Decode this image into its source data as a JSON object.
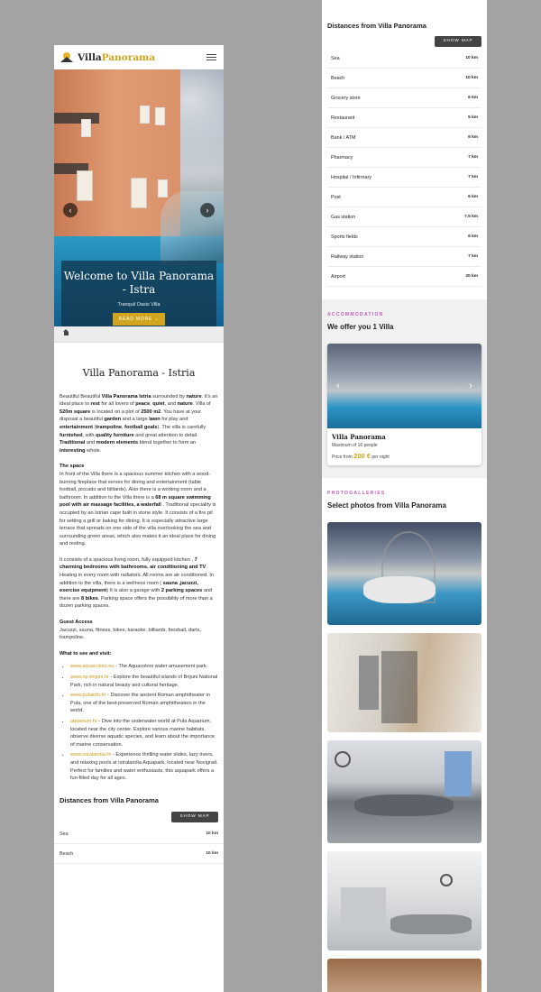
{
  "left": {
    "brand": {
      "part1": "Villa",
      "part2": "Panorama"
    },
    "hero": {
      "title": "Welcome to Villa Panorama - Istra",
      "subtitle": "Tranquil Oasis Villa",
      "button": "READ MORE ⌄",
      "prev": "‹",
      "next": "›"
    },
    "page_title": "Villa Panorama - Istria",
    "intro_html": "Beautiful Beautiful <b>Villa Panorama Istria</b> surrounded by <b>nature</b>. It's an ideal place to <b>rest</b> for all lovers of <b>peace</b>, <b>quiet</b>, and <b>nature</b>. Villa of <b>520m square</b> is located on a plot of <b>2500 m2</b>. You have at your disposal a beautiful <b>garden</b> and a large <b>lawn</b> for play and <b>entertainment</b> (<b>trampoline</b>, <b>football goals</b>). The villa is carefully <b>furnished</b>, with <b>quality furniture</b> and great attention to detail. <b>Traditional</b> and <b>modern elements</b> blend together to form an <b>interesting</b> whole.",
    "space_heading": "The space",
    "space_html": "In front of the Villa there is a spacious summer kitchen with a wood-burning fireplace that serves for dining and entertainment (table football, piccado and billiards). Also there is a working room and a bathroom. In addition to the Villa there is a <b>68 m square swimming pool with air massage facilities, a waterfall</b> . Traditional speciality is occupied by an Istrian cape built in stone style. It consists of a fire pit for setting a grill or baking for dining. It is especially attractive large terrace that spreads on one side of the villa overlooking the sea and surrounding green areas, which also makes it an ideal place for dining and resting.",
    "space2_html": "It consists of a spacious living room, fully equipped kitchen , <b>7 charming bedrooms with bathrooms, air conditioning and TV</b>. Heating in every room with radiators. All rooms are air conditioned. In addition to the villa, there is a wellness room ( <b>sauna ,jacuzzi, exercise equipment</b>) It is also a garage with <b>2 parking spaces</b> and there are <b>8 bikes</b>. Parking space offers the possibility of more than a dozen parking spaces.",
    "guest_heading": "Guest Access",
    "guest_text": "Jacuzzi, sauna, fitness, bikes, karaoke, billiards, foosball, darts, trampoline.",
    "visit_heading": "What to see and visit:",
    "visit_items": [
      {
        "link": "www.aquacolors.eu",
        "text": " - The Aquacolors water amusement park."
      },
      {
        "link": "www.np-brijuni.hr",
        "text": " - Explore the beautiful islands of Brijuni National Park, rich in natural beauty and cultural heritage."
      },
      {
        "link": "www.pulainfo.hr",
        "text": " - Discover the ancient Roman amphitheater in Pula, one of the best-preserved Roman amphitheaters in the world."
      },
      {
        "link": "aquarium.hr",
        "text": " - Dive into the underwater world at Pula Aquarium, located near the city center. Explore various marine habitats, observe diverse aquatic species, and learn about the importance of marine conservation."
      },
      {
        "link": "www.istralandia.hr",
        "text": " - Experience thrilling water slides, lazy rivers, and relaxing pools at Istralandia Aquapark, located near Novigrad. Perfect for families and water enthusiasts, this aquapark offers a fun-filled day for all ages."
      }
    ],
    "distances_title": "Distances from Villa Panorama",
    "show_map": "SHOW MAP",
    "distances": [
      {
        "place": "Sea",
        "km": "10 km"
      },
      {
        "place": "Beach",
        "km": "10 km"
      }
    ]
  },
  "right": {
    "distances_title": "Distances from Villa Panorama",
    "show_map": "SHOW MAP",
    "distances": [
      {
        "place": "Sea",
        "km": "10 km"
      },
      {
        "place": "Beach",
        "km": "10 km"
      },
      {
        "place": "Grocery store",
        "km": "6 km"
      },
      {
        "place": "Restaurant",
        "km": "5 km"
      },
      {
        "place": "Bank / ATM",
        "km": "6 km"
      },
      {
        "place": "Pharmacy",
        "km": "7 km"
      },
      {
        "place": "Hospital / Infirmary",
        "km": "7 km"
      },
      {
        "place": "Post",
        "km": "6 km"
      },
      {
        "place": "Gas station",
        "km": "7.5 km"
      },
      {
        "place": "Sports fields",
        "km": "6 km"
      },
      {
        "place": "Railway station",
        "km": "7 km"
      },
      {
        "place": "Airport",
        "km": "20 km"
      }
    ],
    "accommodation_kicker": "ACCOMMODATION",
    "accommodation_heading": "We offer you 1 Villa",
    "villa_card": {
      "name": "Villa Panorama",
      "max": "Maximum of 16 people",
      "price_prefix": "Price from",
      "price": "200 €",
      "price_suffix": "per night"
    },
    "photos_kicker": "PHOTOGALLERIES",
    "photos_heading": "Select photos from Villa Panorama"
  },
  "colors": {
    "accent": "#d1a51e",
    "kicker": "#c659c2",
    "hero_card": "#12344a"
  }
}
